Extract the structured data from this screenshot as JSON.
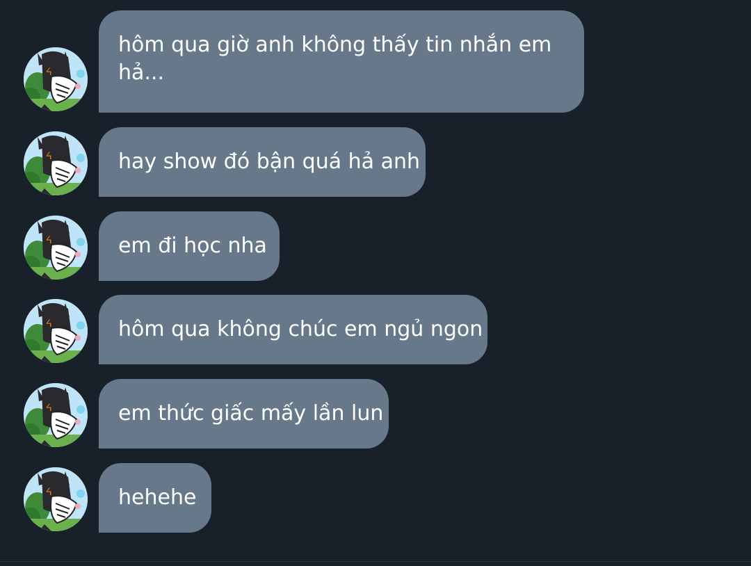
{
  "messages": [
    {
      "text": "hôm qua giờ anh không thấy tin nhắn em hả..."
    },
    {
      "text": "hay show đó bận quá hả anh"
    },
    {
      "text": "em đi học nha"
    },
    {
      "text": "hôm qua không chúc em ngủ ngon"
    },
    {
      "text": "em thức giấc mấy lần lun"
    },
    {
      "text": "hehehe"
    }
  ],
  "colors": {
    "background": "#18202a",
    "bubble": "#66788a",
    "text": "#ffffff"
  }
}
